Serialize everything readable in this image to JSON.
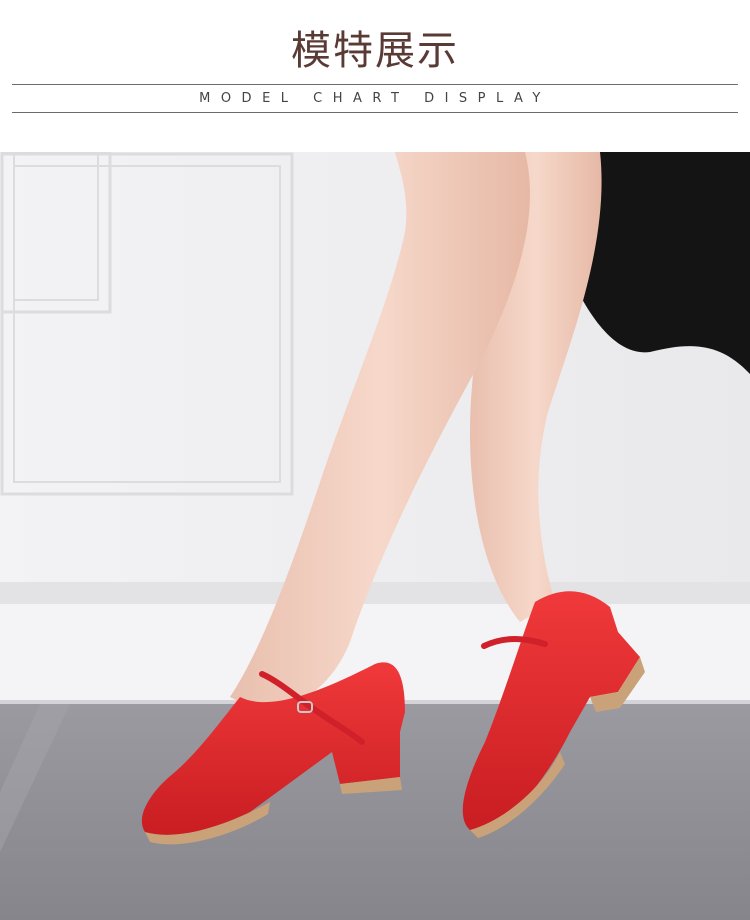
{
  "header": {
    "title": "模特展示",
    "subtitle": "MODEL CHART DISPLAY"
  },
  "photo": {
    "subject": "model-legs-red-shoes",
    "colors": {
      "wall": "#f1f1f3",
      "floor": "#8f8f95",
      "skirt": "#141414",
      "skin": "#f2cdbd",
      "shoe": "#e32a2c",
      "sole": "#caa27a"
    }
  }
}
